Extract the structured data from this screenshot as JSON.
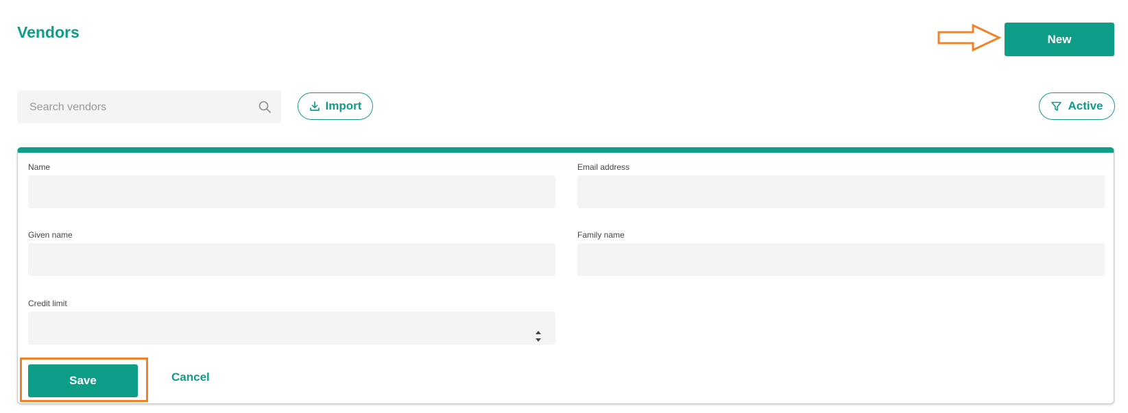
{
  "header": {
    "title": "Vendors",
    "new_label": "New"
  },
  "toolbar": {
    "search_placeholder": "Search vendors",
    "import_label": "Import",
    "filter_label": "Active"
  },
  "form": {
    "fields": {
      "name_label": "Name",
      "email_label": "Email address",
      "given_name_label": "Given name",
      "family_name_label": "Family name",
      "credit_limit_label": "Credit limit"
    },
    "save_label": "Save",
    "cancel_label": "Cancel"
  },
  "colors": {
    "accent": "#0e9e88",
    "annotation": "#f08228"
  },
  "icons": {
    "search": "search-icon",
    "import": "download-icon",
    "filter": "filter-icon",
    "annotation": "arrow-right-icon"
  }
}
